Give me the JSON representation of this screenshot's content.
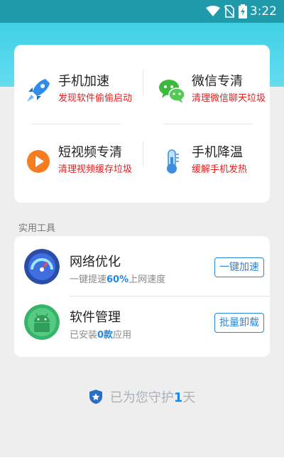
{
  "status_bar": {
    "time": "3:22"
  },
  "features": [
    {
      "title": "手机加速",
      "desc": "发现软件偷偷启动",
      "icon": "rocket-icon"
    },
    {
      "title": "微信专清",
      "desc": "清理微信聊天垃圾",
      "icon": "wechat-icon"
    },
    {
      "title": "短视频专清",
      "desc": "清理视频缓存垃圾",
      "icon": "play-video-icon"
    },
    {
      "title": "手机降温",
      "desc": "缓解手机发热",
      "icon": "thermometer-icon"
    }
  ],
  "tools_section": {
    "label": "实用工具"
  },
  "tools": [
    {
      "title": "网络优化",
      "desc_pre": "一键提速",
      "desc_highlight": "60%",
      "desc_post": "上网速度",
      "button": "一键加速",
      "icon": "speedometer-icon"
    },
    {
      "title": "软件管理",
      "desc_pre": "已安装",
      "desc_highlight": "0款",
      "desc_post": "应用",
      "button": "批量卸载",
      "icon": "android-icon"
    }
  ],
  "guard": {
    "pre": "已为您守护",
    "days": "1",
    "post": "天"
  },
  "colors": {
    "accent": "#1e88e5",
    "warning_text": "#e02020",
    "header": "#3fd0e6"
  }
}
